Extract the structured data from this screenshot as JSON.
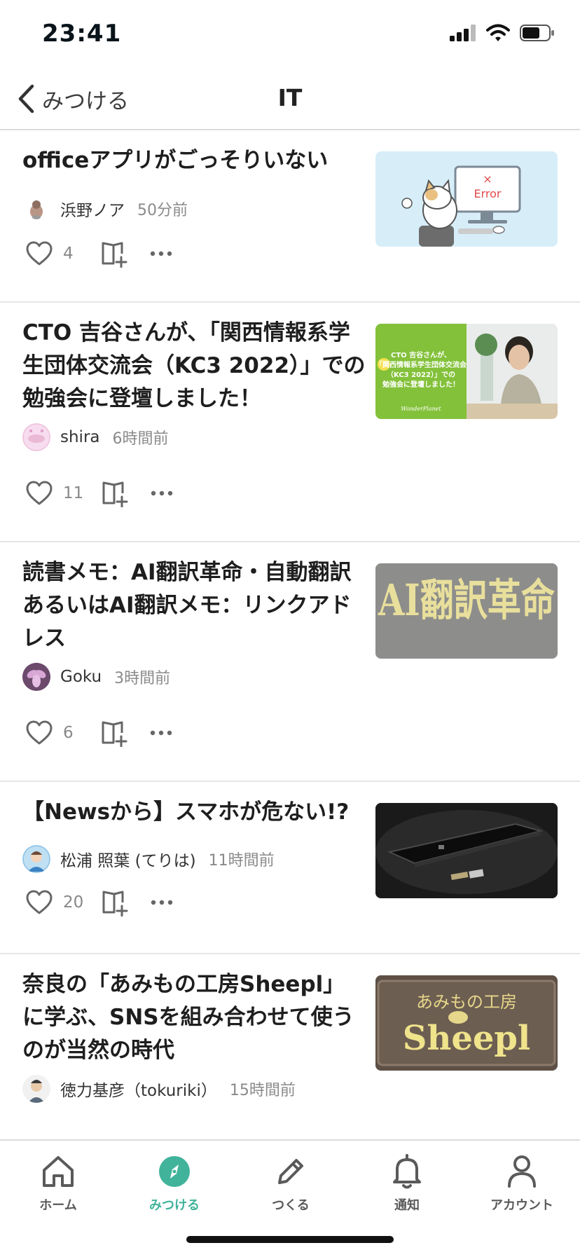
{
  "status": {
    "time": "23:41"
  },
  "nav": {
    "back_label": "みつける",
    "title": "IT"
  },
  "articles": [
    {
      "title": "officeアプリがごっそりいない",
      "author": "浜野ノア",
      "time": "50分前",
      "likes": "4",
      "thumb_text": "Error"
    },
    {
      "title": "CTO 吉谷さんが、「関西情報系学生団体交流会（KC3 2022）」での勉強会に登壇しました！",
      "author": "shira",
      "time": "6時間前",
      "likes": "11",
      "thumb_text": "CTO 吉谷さんが、「関西情報系学生団体交流会（KC3 2022）」での勉強会に登壇しました！"
    },
    {
      "title": "読書メモ：AI翻訳革命・自動翻訳あるいはAI翻訳メモ：リンクアドレス",
      "author": "Goku",
      "time": "3時間前",
      "likes": "6",
      "thumb_text": "AI翻訳革命"
    },
    {
      "title": "【Newsから】スマホが危ない!?",
      "author": "松浦 照葉 (てりは)",
      "time": "11時間前",
      "likes": "20",
      "thumb_text": ""
    },
    {
      "title": "奈良の「あみもの工房Sheepl」に学ぶ、SNSを組み合わせて使うのが当然の時代",
      "author": "徳力基彦（tokuriki）",
      "time": "15時間前",
      "likes": "",
      "thumb_text": "Sheepl",
      "thumb_subtext": "あみもの工房"
    }
  ],
  "tabs": [
    {
      "label": "ホーム",
      "icon": "home-icon"
    },
    {
      "label": "みつける",
      "icon": "compass-icon"
    },
    {
      "label": "つくる",
      "icon": "pencil-icon"
    },
    {
      "label": "通知",
      "icon": "bell-icon"
    },
    {
      "label": "アカウント",
      "icon": "person-icon"
    }
  ],
  "colors": {
    "accent": "#41b39b",
    "text": "#1e1e1e",
    "muted": "#8a8a8a",
    "divider": "#e6e6e6"
  }
}
